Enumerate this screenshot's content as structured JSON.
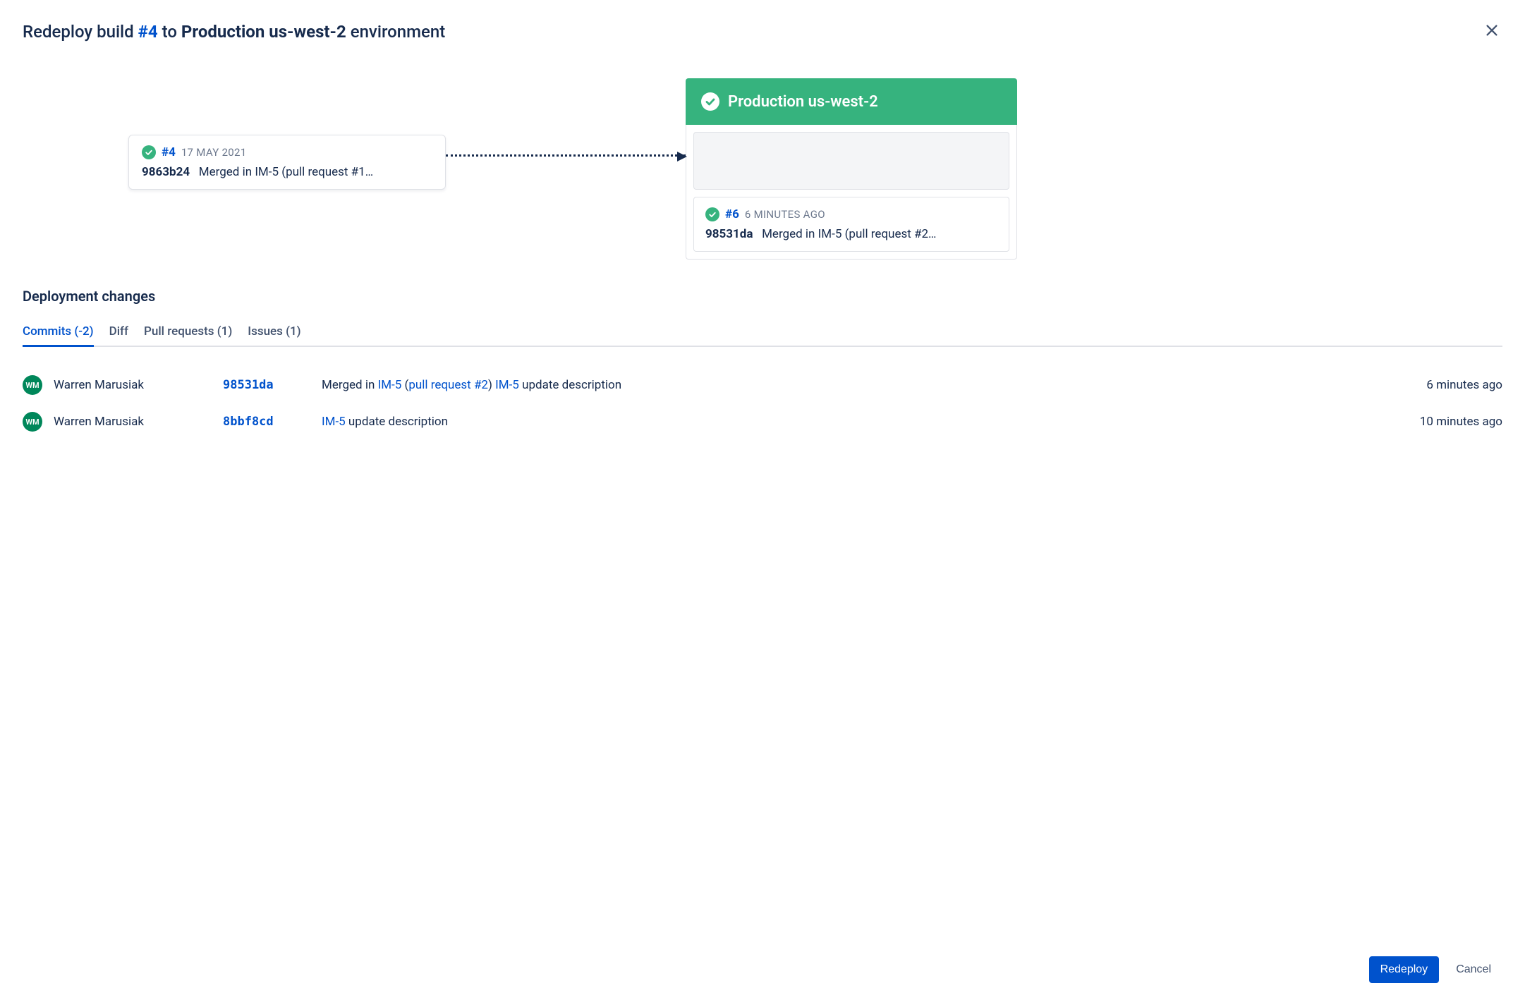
{
  "header": {
    "prefix": "Redeploy build ",
    "build_link": "#4",
    "mid": " to ",
    "env": "Production us-west-2",
    "suffix": " environment"
  },
  "source": {
    "build": "#4",
    "time": "17 MAY 2021",
    "hash": "9863b24",
    "message": "Merged in IM-5 (pull request #1…"
  },
  "environment": {
    "name": "Production us-west-2"
  },
  "dest": {
    "build": "#6",
    "time": "6 MINUTES AGO",
    "hash": "98531da",
    "message": "Merged in IM-5 (pull request #2…"
  },
  "section_title": "Deployment changes",
  "tabs": {
    "commits": "Commits (-2)",
    "diff": "Diff",
    "pull_requests": "Pull requests (1)",
    "issues": "Issues (1)"
  },
  "commits": [
    {
      "initials": "WM",
      "author": "Warren Marusiak",
      "hash": "98531da",
      "msg_prefix": "Merged in ",
      "issue1": "IM-5",
      "msg_paren_open": " (",
      "pr": "pull request #2",
      "msg_paren_close": ") ",
      "issue2": "IM-5",
      "msg_suffix": " update description",
      "time": "6 minutes ago"
    },
    {
      "initials": "WM",
      "author": "Warren Marusiak",
      "hash": "8bbf8cd",
      "msg_prefix": "",
      "issue1": "IM-5",
      "msg_paren_open": "",
      "pr": "",
      "msg_paren_close": "",
      "issue2": "",
      "msg_suffix": " update description",
      "time": "10 minutes ago"
    }
  ],
  "footer": {
    "redeploy": "Redeploy",
    "cancel": "Cancel"
  }
}
